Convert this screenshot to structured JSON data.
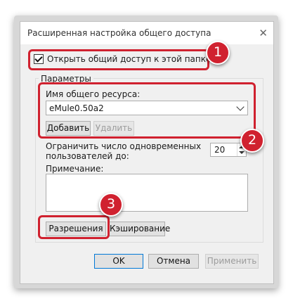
{
  "dialog": {
    "title": "Расширенная настройка общего доступа",
    "close_glyph": "✕"
  },
  "share_checkbox": {
    "label": "Открыть общий доступ к этой папке",
    "checked": true
  },
  "params": {
    "group_label": "Параметры",
    "share_name_label": "Имя общего ресурса:",
    "share_name_value": "eMule0.50a2",
    "add_button": "Добавить",
    "remove_button": "Удалить",
    "limit_label_line1": "Ограничить число одновременных",
    "limit_label_line2": "пользователей до:",
    "limit_value": "20",
    "note_label": "Примечание:",
    "permissions_button": "Разрешения",
    "caching_button": "Кэширование"
  },
  "footer": {
    "ok": "OK",
    "cancel": "Отмена",
    "apply": "Применить"
  },
  "badges": {
    "b1": "1",
    "b2": "2",
    "b3": "3"
  },
  "colors": {
    "highlight": "#d0212f",
    "dialog_bg": "#f0f0f0"
  }
}
